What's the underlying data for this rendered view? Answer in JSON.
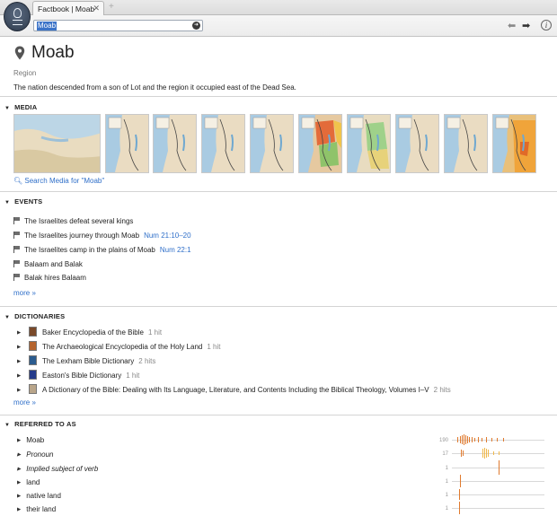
{
  "window": {
    "tab_label": "Factbook | Moab",
    "tab_close_icon": "close-icon",
    "new_tab_symbol": "+",
    "search_value": "Moab",
    "back_symbol": "🡐",
    "forward_symbol": "🡒",
    "info_symbol": "i"
  },
  "header": {
    "title": "Moab",
    "subtitle": "Region",
    "description": "The nation descended from a son of Lot and the region it occupied east of the Dead Sea."
  },
  "media": {
    "heading": "MEDIA",
    "thumbnails": [
      "map-middle-east",
      "map-route-1",
      "map-route-2",
      "map-route-3",
      "map-route-4",
      "map-tribes",
      "map-kingdoms",
      "map-region-1",
      "map-region-2",
      "map-region-3"
    ],
    "search_link": "Search Media for \"Moab\""
  },
  "events": {
    "heading": "EVENTS",
    "items": [
      {
        "label": "The Israelites defeat several kings",
        "ref": ""
      },
      {
        "label": "The Israelites journey through Moab",
        "ref": "Num 21:10–20"
      },
      {
        "label": "The Israelites camp in the plains of Moab",
        "ref": "Num 22:1"
      },
      {
        "label": "Balaam and Balak",
        "ref": ""
      },
      {
        "label": "Balak hires Balaam",
        "ref": ""
      }
    ],
    "more": "more »"
  },
  "dictionaries": {
    "heading": "DICTIONARIES",
    "items": [
      {
        "title": "Baker Encyclopedia of the Bible",
        "hits": "1 hit",
        "cover": "#7a4a2a"
      },
      {
        "title": "The Archaeological Encyclopedia of the Holy Land",
        "hits": "1 hit",
        "cover": "#b5642e"
      },
      {
        "title": "The Lexham Bible Dictionary",
        "hits": "2 hits",
        "cover": "#2b5c8f"
      },
      {
        "title": "Easton's Bible Dictionary",
        "hits": "1 hit",
        "cover": "#243a8a"
      },
      {
        "title": "A Dictionary of the Bible: Dealing with Its Language, Literature, and Contents Including the Biblical Theology, Volumes I–V",
        "hits": "2 hits",
        "cover": "#b9a58a"
      }
    ],
    "more": "more »"
  },
  "referred_to_as": {
    "heading": "REFERRED TO AS",
    "items": [
      {
        "label": "Moab",
        "italic": false,
        "count": "190"
      },
      {
        "label": "Pronoun",
        "italic": true,
        "count": "17"
      },
      {
        "label": "Implied subject of verb",
        "italic": true,
        "count": "1"
      },
      {
        "label": "land",
        "italic": false,
        "count": "1"
      },
      {
        "label": "native land",
        "italic": false,
        "count": "1"
      },
      {
        "label": "their land",
        "italic": false,
        "count": "1"
      }
    ]
  },
  "colors": {
    "link": "#2f6fc9",
    "sparkline": "#e07a2e",
    "selection": "#3b73c8"
  }
}
